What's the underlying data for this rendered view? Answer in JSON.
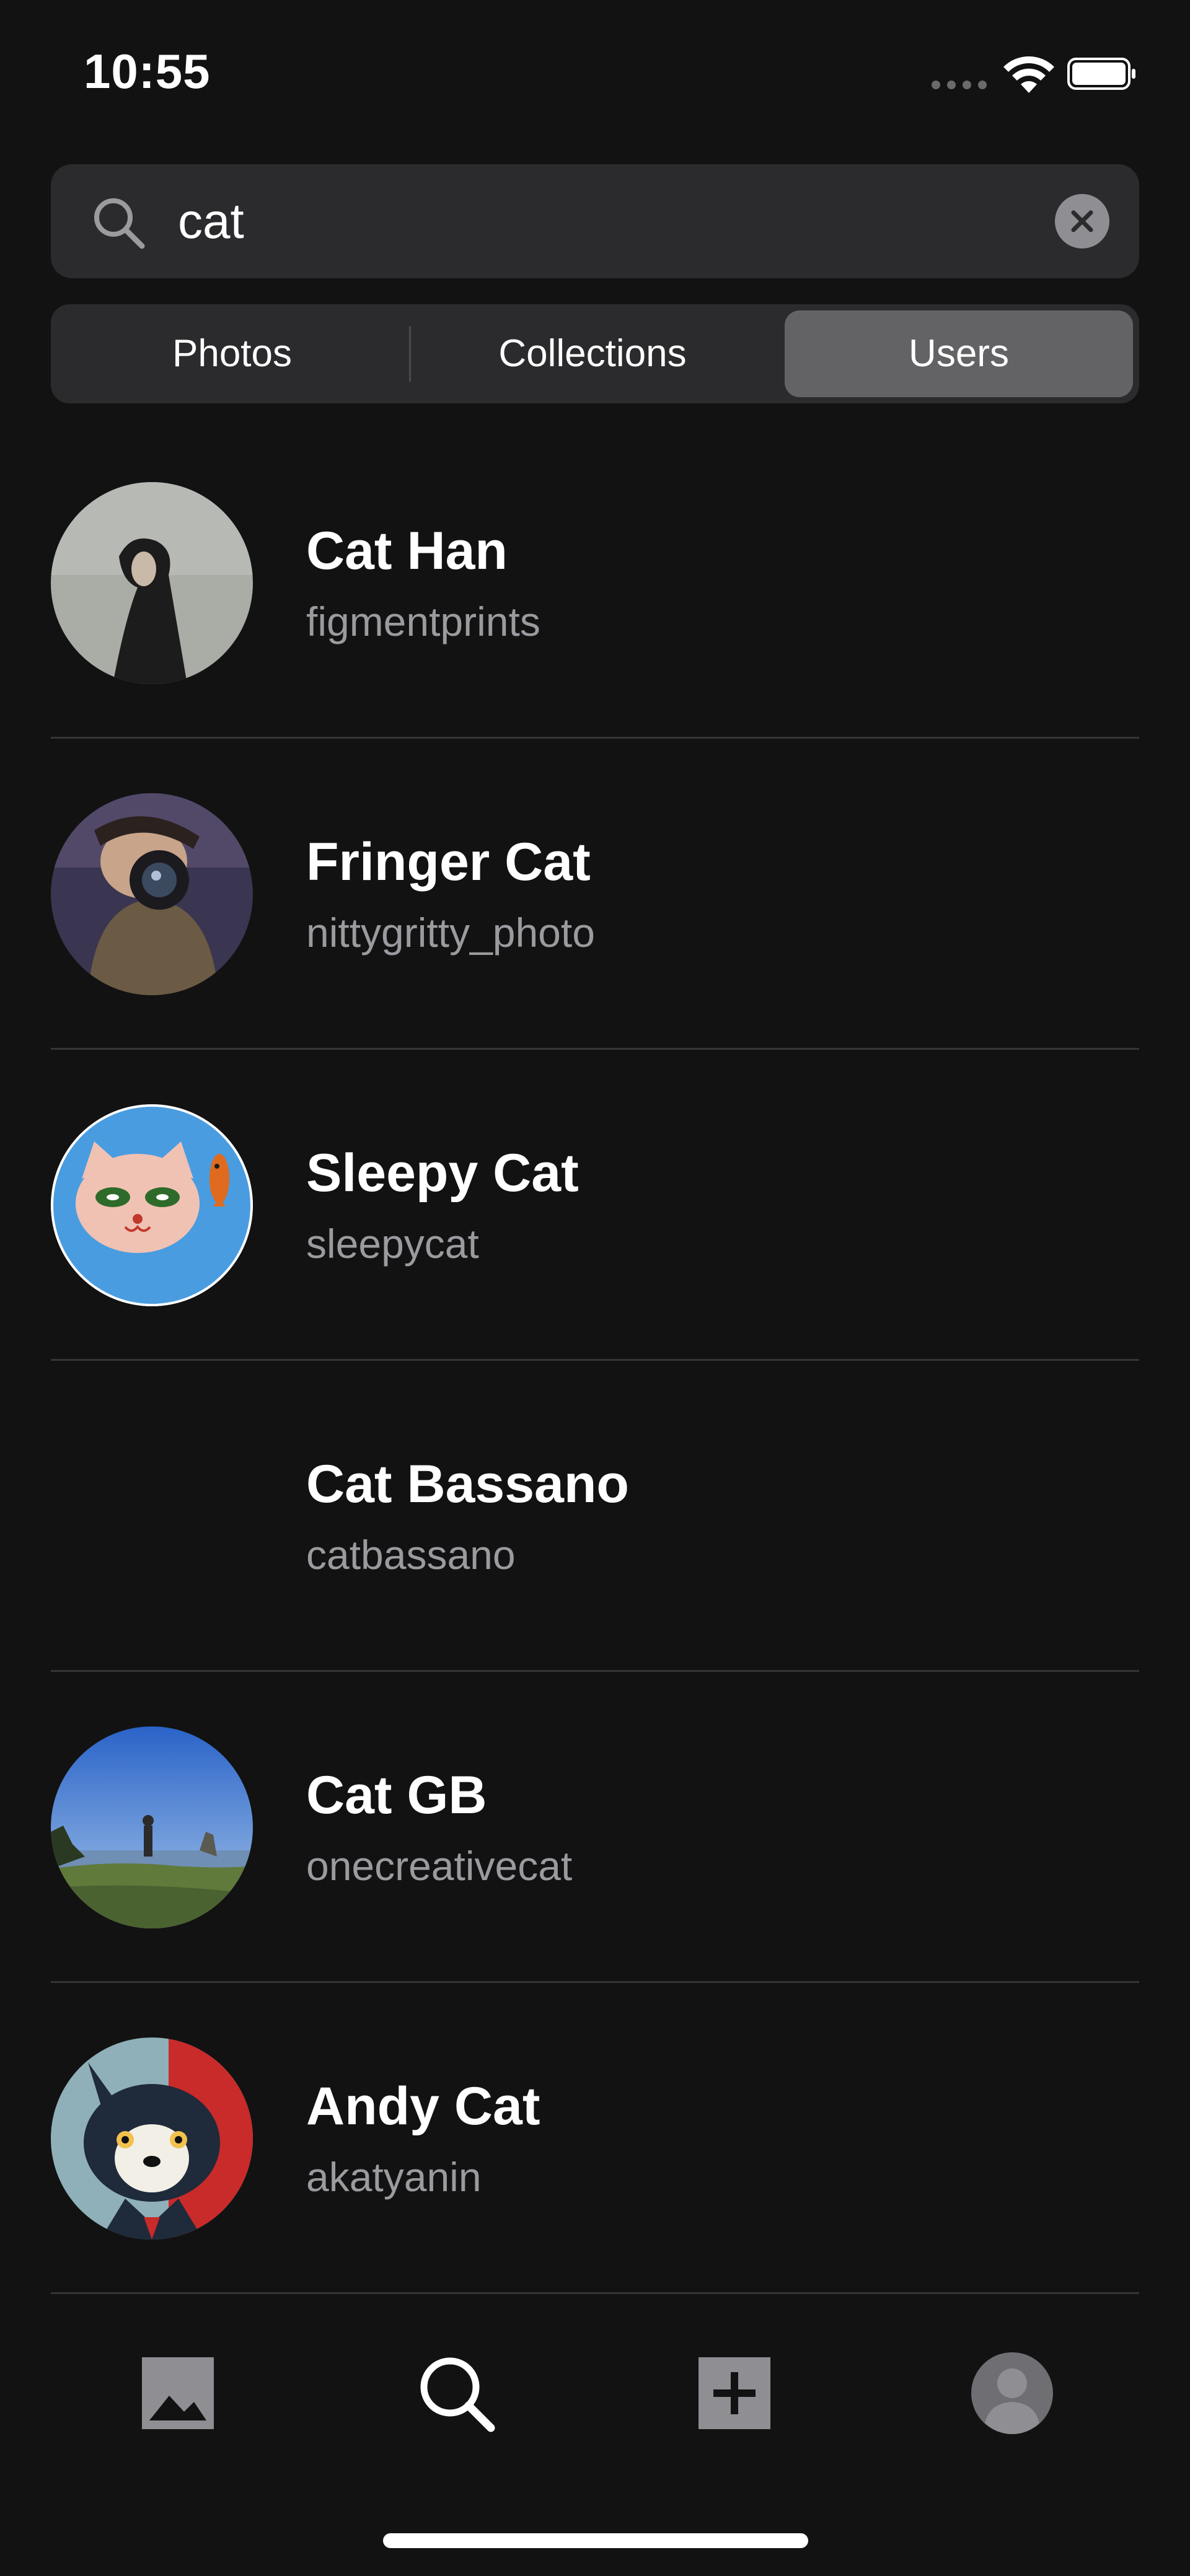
{
  "status_bar": {
    "time": "10:55"
  },
  "search": {
    "query": "cat",
    "icon": "search-icon",
    "clear_icon": "clear-icon"
  },
  "segments": {
    "items": [
      {
        "label": "Photos",
        "active": false
      },
      {
        "label": "Collections",
        "active": false
      },
      {
        "label": "Users",
        "active": true
      }
    ]
  },
  "users": [
    {
      "name": "Cat Han",
      "handle": "figmentprints",
      "avatar": "photo-portrait"
    },
    {
      "name": "Fringer Cat",
      "handle": "nittygritty_photo",
      "avatar": "photo-camera"
    },
    {
      "name": "Sleepy Cat",
      "handle": "sleepycat",
      "avatar": "illustration-cat"
    },
    {
      "name": "Cat Bassano",
      "handle": "catbassano",
      "avatar": "none"
    },
    {
      "name": "Cat GB",
      "handle": "onecreativecat",
      "avatar": "photo-landscape"
    },
    {
      "name": "Andy Cat",
      "handle": "akatyanin",
      "avatar": "illustration-dog"
    }
  ],
  "tab_bar": {
    "items": [
      {
        "icon": "photos-icon",
        "active": false
      },
      {
        "icon": "search-icon",
        "active": true
      },
      {
        "icon": "add-icon",
        "active": false
      },
      {
        "icon": "profile-icon",
        "active": false
      }
    ]
  },
  "colors": {
    "background": "#121212",
    "surface": "#2b2b2d",
    "segment_active": "#636366",
    "secondary_text": "#9a9a9f"
  }
}
